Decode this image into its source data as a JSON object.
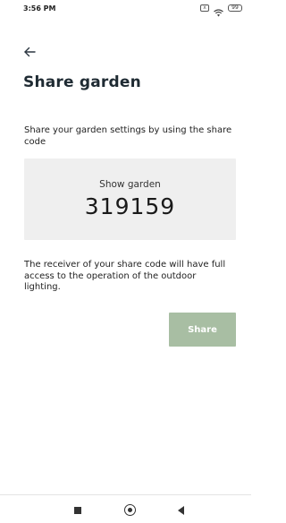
{
  "status_bar": {
    "time": "3:56 PM",
    "battery_level": "99",
    "notification_icon_label": "x"
  },
  "header": {
    "title": "Share garden",
    "back_icon": "arrow-left-icon"
  },
  "main": {
    "intro": "Share your garden settings by using the share code",
    "code_card": {
      "label": "Show garden",
      "code": "319159"
    },
    "info": "The receiver of your share code will have full access to the operation of the outdoor lighting.",
    "share_button": {
      "label": "Share",
      "color": "#a8bea3"
    }
  },
  "navigation_bar": {
    "recents_icon": "square-icon",
    "home_icon": "circle-icon",
    "back_icon": "triangle-back-icon"
  }
}
